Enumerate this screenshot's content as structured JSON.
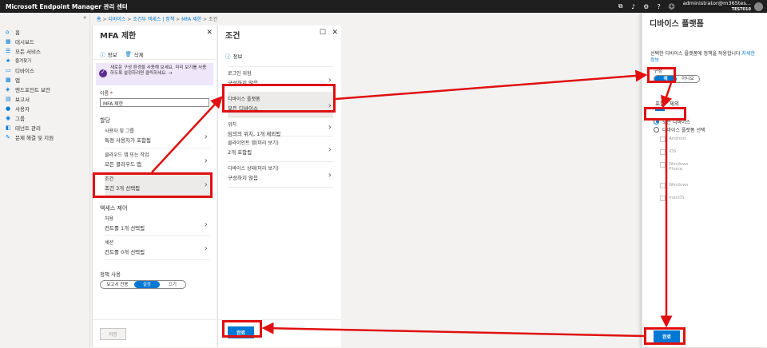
{
  "topbar": {
    "title": "Microsoft Endpoint Manager 관리 센터",
    "account": "administrator@m365tes...",
    "tenant": "TEST010",
    "icons": [
      "remote-icon",
      "notification-icon",
      "gear-icon",
      "help-icon",
      "feedback-icon"
    ]
  },
  "sidenav": {
    "collapse": "«",
    "items": [
      {
        "icon": "home-icon",
        "glyph": "⌂",
        "label": "홈"
      },
      {
        "icon": "dashboard-icon",
        "glyph": "▦",
        "label": "대시보드"
      },
      {
        "icon": "all-services-icon",
        "glyph": "☰",
        "label": "모든 서비스"
      },
      {
        "icon": "star-icon",
        "glyph": "★",
        "label": "즐겨찾기",
        "small": true
      },
      {
        "icon": "devices-icon",
        "glyph": "▭",
        "label": "디바이스"
      },
      {
        "icon": "apps-icon",
        "glyph": "▩",
        "label": "앱"
      },
      {
        "icon": "endpoint-security-icon",
        "glyph": "◈",
        "label": "엔드포인트 보안"
      },
      {
        "icon": "reports-icon",
        "glyph": "▤",
        "label": "보고서"
      },
      {
        "icon": "users-icon",
        "glyph": "●",
        "label": "사용자"
      },
      {
        "icon": "groups-icon",
        "glyph": "◉",
        "label": "그룹"
      },
      {
        "icon": "tenant-admin-icon",
        "glyph": "◧",
        "label": "테넌트 관리"
      },
      {
        "icon": "troubleshoot-icon",
        "glyph": "✎",
        "label": "문제 해결 및 지원"
      }
    ]
  },
  "breadcrumb": {
    "items": [
      "홈",
      "디바이스",
      "조건부 액세스 | 정책",
      "MFA 제한",
      "조건"
    ]
  },
  "mfa": {
    "title": "MFA 제한",
    "info": "정보",
    "delete": "삭제",
    "banner": "새로운 구성 환경을 사용해 보세요. 미리 보기를 사용하도록 설정하려면 클릭하세요. →",
    "name_label": "이름",
    "name_value": "MFA 제한",
    "assign": "할당",
    "users_label": "사용자 및 그룹",
    "users_value": "특정 사용자가 포함됨",
    "cloud_label": "클라우드 앱 또는 작업",
    "cloud_value": "모든 클라우드 앱",
    "cond_label": "조건",
    "cond_value": "조건 3개 선택됨",
    "access": "액세스 제어",
    "grant_label": "허용",
    "grant_value": "컨트롤 1개 선택됨",
    "session_label": "세션",
    "session_value": "컨트롤 0개 선택됨",
    "policy_label": "정책 사용",
    "policy_opts": [
      "보고서 전용",
      "설정",
      "끄기"
    ],
    "save": "저장"
  },
  "cond": {
    "title": "조건",
    "info": "정보",
    "rows": [
      {
        "l1": "로그인 위험",
        "l2": "구성하지 않음"
      },
      {
        "l1": "디바이스 플랫폼",
        "l2": "모든 디바이스"
      },
      {
        "l1": "위치",
        "l2": "임의의 위치, 1개 제외됨"
      },
      {
        "l1": "클라이언트 앱(미리 보기)",
        "l2": "2개 포함됨"
      },
      {
        "l1": "디바이스 상태(미리 보기)",
        "l2": "구성하지 않음"
      }
    ],
    "done": "완료"
  },
  "platform": {
    "title": "디바이스 플랫폼",
    "desc": "선택한 디바이스 플랫폼에 정책을 적용합니다.",
    "more": "자세한 정보",
    "config_label": "구성",
    "yes": "예",
    "no": "아니요",
    "tab_include": "포함",
    "tab_exclude": "제외",
    "radio_all": "모든 디바이스",
    "radio_select": "디바이스 플랫폼 선택",
    "platforms": [
      "Android",
      "iOS",
      "Windows Phone",
      "Windows",
      "macOS"
    ],
    "done": "완료"
  }
}
